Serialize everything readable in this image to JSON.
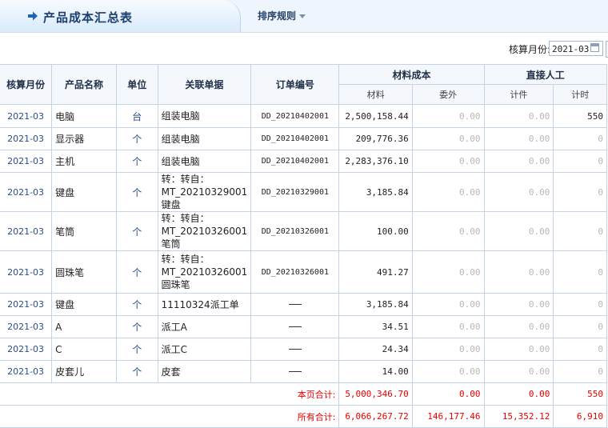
{
  "header": {
    "title": "产品成本汇总表",
    "sort_label": "排序规则"
  },
  "filter": {
    "label": "核算月份:",
    "value": "2021-03"
  },
  "columns": {
    "month": "核算月份",
    "product": "产品名称",
    "unit": "单位",
    "related": "关联单据",
    "order": "订单编号",
    "material_group": "材料成本",
    "material": "材料",
    "outsource": "委外",
    "labor_group": "直接人工",
    "piece": "计件",
    "time": "计时"
  },
  "rows": [
    {
      "month": "2021-03",
      "product": "电脑",
      "unit": "台",
      "related": "组装电脑",
      "order": "DD_20210402001",
      "material": "2,500,158.44",
      "outsource": "0.00",
      "piece": "0.00",
      "time": "550"
    },
    {
      "month": "2021-03",
      "product": "显示器",
      "unit": "个",
      "related": "组装电脑",
      "order": "DD_20210402001",
      "material": "209,776.36",
      "outsource": "0.00",
      "piece": "0.00",
      "time": "0"
    },
    {
      "month": "2021-03",
      "product": "主机",
      "unit": "个",
      "related": "组装电脑",
      "order": "DD_20210402001",
      "material": "2,283,376.10",
      "outsource": "0.00",
      "piece": "0.00",
      "time": "0"
    },
    {
      "month": "2021-03",
      "product": "键盘",
      "unit": "个",
      "related": "转：转自：MT_20210329001 键盘",
      "order": "DD_20210329001",
      "material": "3,185.84",
      "outsource": "0.00",
      "piece": "0.00",
      "time": "0"
    },
    {
      "month": "2021-03",
      "product": "笔筒",
      "unit": "个",
      "related": "转：转自：MT_20210326001 笔筒",
      "order": "DD_20210326001",
      "material": "100.00",
      "outsource": "0.00",
      "piece": "0.00",
      "time": "0"
    },
    {
      "month": "2021-03",
      "product": "圆珠笔",
      "unit": "个",
      "related": "转：转自：MT_20210326001 圆珠笔",
      "order": "DD_20210326001",
      "material": "491.27",
      "outsource": "0.00",
      "piece": "0.00",
      "time": "0"
    },
    {
      "month": "2021-03",
      "product": "键盘",
      "unit": "个",
      "related": "11110324派工单",
      "order": "",
      "material": "3,185.84",
      "outsource": "0.00",
      "piece": "0.00",
      "time": "0"
    },
    {
      "month": "2021-03",
      "product": "A",
      "unit": "个",
      "related": "派工A",
      "order": "",
      "material": "34.51",
      "outsource": "0.00",
      "piece": "0.00",
      "time": "0"
    },
    {
      "month": "2021-03",
      "product": "C",
      "unit": "个",
      "related": "派工C",
      "order": "",
      "material": "24.34",
      "outsource": "0.00",
      "piece": "0.00",
      "time": "0"
    },
    {
      "month": "2021-03",
      "product": "皮套儿",
      "unit": "个",
      "related": "皮套",
      "order": "",
      "material": "14.00",
      "outsource": "0.00",
      "piece": "0.00",
      "time": "0"
    }
  ],
  "totals": [
    {
      "label": "本页合计:",
      "material": "5,000,346.70",
      "outsource": "0.00",
      "piece": "0.00",
      "time": "550"
    },
    {
      "label": "所有合计:",
      "material": "6,066,267.72",
      "outsource": "146,177.46",
      "piece": "15,352.12",
      "time": "6,910"
    }
  ]
}
